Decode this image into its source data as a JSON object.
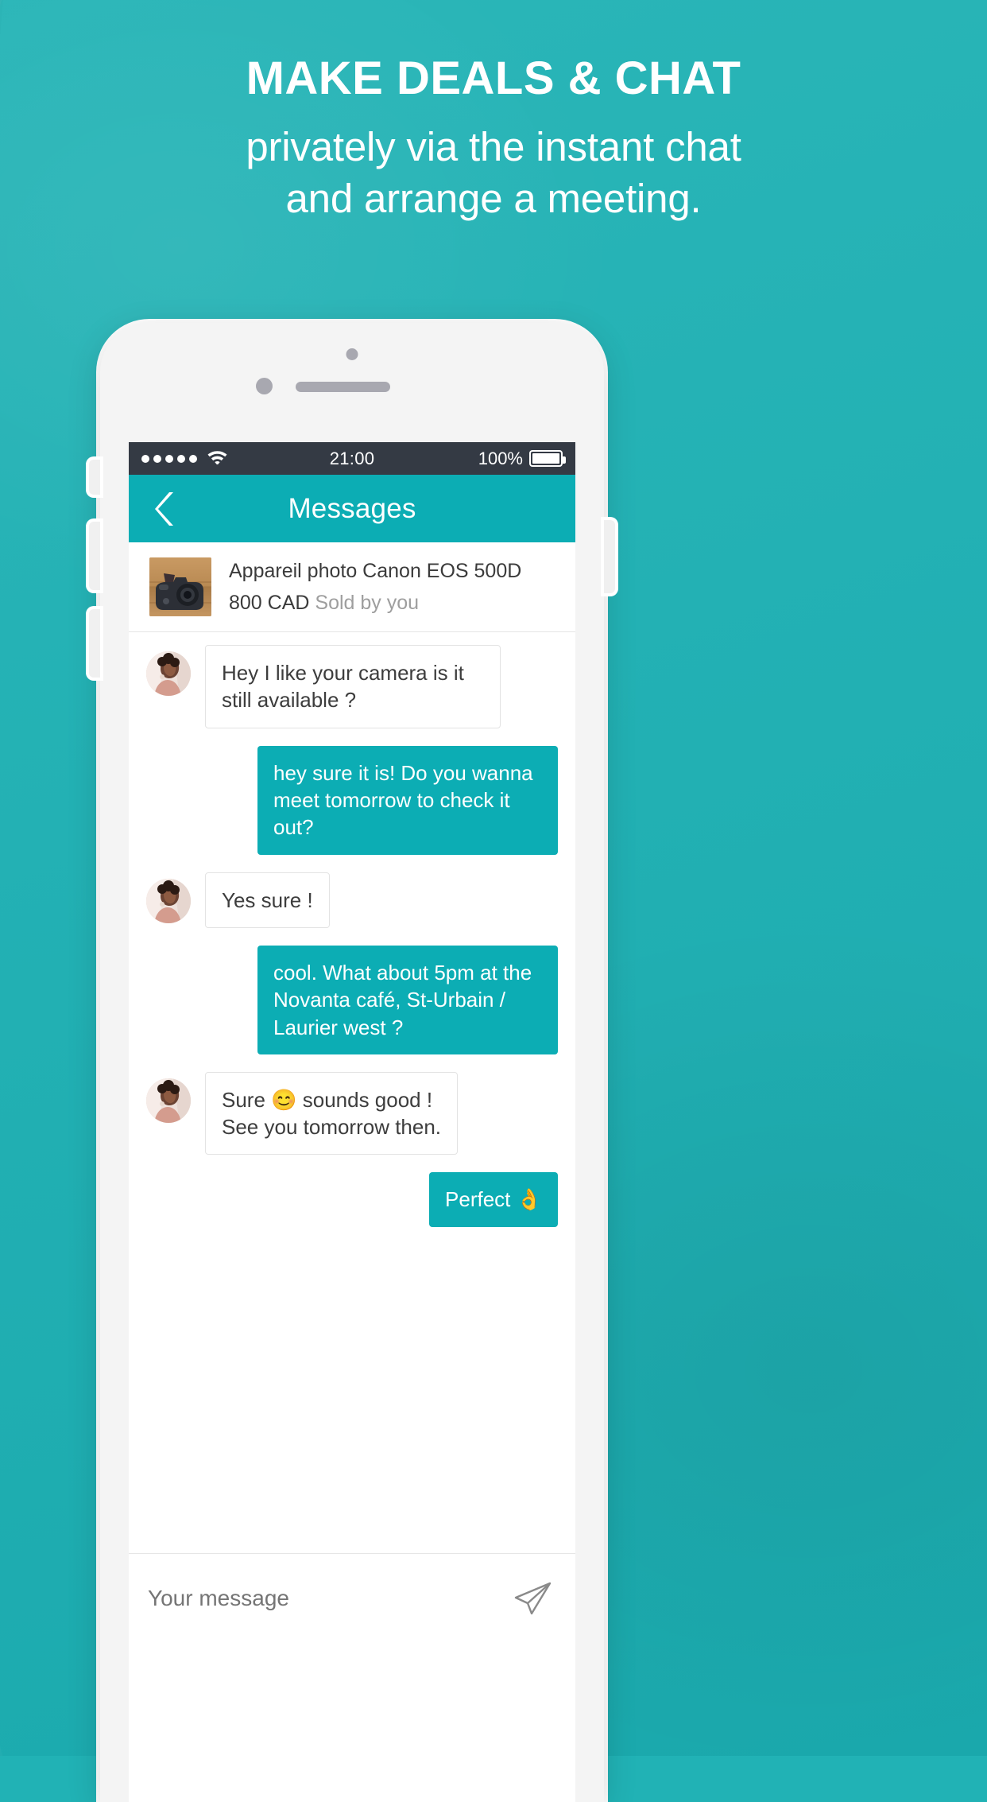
{
  "headline": {
    "line1": "MAKE DEALS & CHAT",
    "line2": "privately via the instant chat",
    "line3": "and arrange a meeting."
  },
  "colors": {
    "brand_teal": "#21b2b5",
    "nav_teal": "#0cadb4",
    "statusbar": "#343a44",
    "bubble_out": "#0cadb4",
    "bubble_in_border": "#e3e3e3"
  },
  "phone": {
    "statusbar": {
      "signal_dots": 5,
      "wifi_icon": "wifi-icon",
      "time": "21:00",
      "battery_percent": "100%",
      "battery_level": 100
    },
    "navbar": {
      "back_icon": "chevron-left-icon",
      "title": "Messages"
    },
    "product": {
      "thumb_icon": "camera-photo-thumbnail",
      "title": "Appareil photo Canon EOS 500D",
      "price": "800 CAD",
      "status": "Sold by you"
    },
    "messages": [
      {
        "side": "in",
        "text": "Hey I like your camera is it still available ?",
        "avatar": "contact-avatar"
      },
      {
        "side": "out",
        "text": "hey sure it is! Do you wanna meet tomorrow to check it out?"
      },
      {
        "side": "in",
        "text": "Yes sure !",
        "avatar": "contact-avatar"
      },
      {
        "side": "out",
        "text": "cool. What about 5pm at the Novanta café, St-Urbain / Laurier west ?"
      },
      {
        "side": "in",
        "text": "Sure 😊 sounds good !\nSee you tomorrow then.",
        "avatar": "contact-avatar"
      },
      {
        "side": "out",
        "text": "Perfect 👌"
      }
    ],
    "composer": {
      "placeholder": "Your message",
      "value": "",
      "send_icon": "send-paper-plane-icon"
    }
  }
}
